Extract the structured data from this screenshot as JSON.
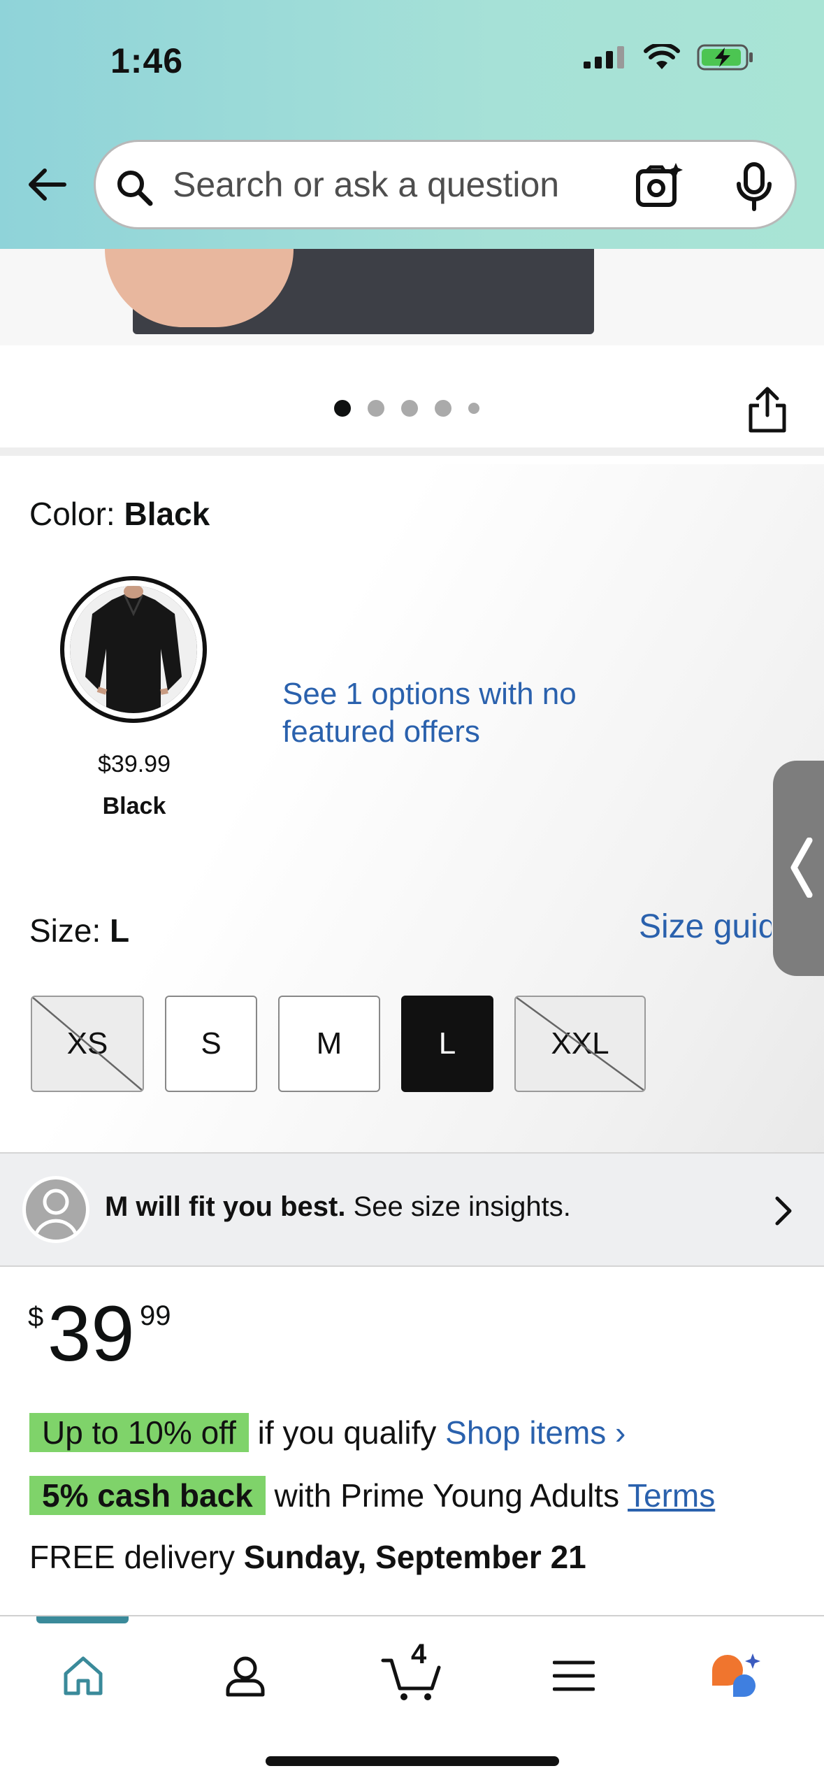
{
  "status_bar": {
    "time": "1:46"
  },
  "search": {
    "placeholder": "Search or ask a question"
  },
  "carousel": {
    "dot_count": 5,
    "active_index": 0
  },
  "color": {
    "label": "Color: ",
    "value": "Black",
    "option": {
      "price": "$39.99",
      "name": "Black"
    },
    "see_options": "See 1 options with no featured offers"
  },
  "size": {
    "label": "Size: ",
    "value": "L",
    "guide_link": "Size guide",
    "options": [
      {
        "label": "XS",
        "state": "unavailable"
      },
      {
        "label": "S",
        "state": "available"
      },
      {
        "label": "M",
        "state": "available"
      },
      {
        "label": "L",
        "state": "selected"
      },
      {
        "label": "XXL",
        "state": "unavailable"
      }
    ]
  },
  "fit": {
    "bold": "M will fit you best.",
    "text": " See size insights."
  },
  "price": {
    "symbol": "$",
    "whole": "39",
    "fraction": "99"
  },
  "promos": {
    "discount_badge": "Up to 10% off",
    "discount_text": " if you qualify ",
    "discount_link": "Shop items ›",
    "cashback_badge": "5% cash back",
    "cashback_text": " with Prime Young Adults ",
    "cashback_link": "Terms"
  },
  "delivery": {
    "prefix": "FREE delivery ",
    "date": "Sunday, September 21"
  },
  "nav": {
    "cart_count": "4"
  },
  "colors": {
    "accent_link": "#2a61ad",
    "promo_green": "#7fd36a",
    "header_teal": "#8fd3d9"
  }
}
